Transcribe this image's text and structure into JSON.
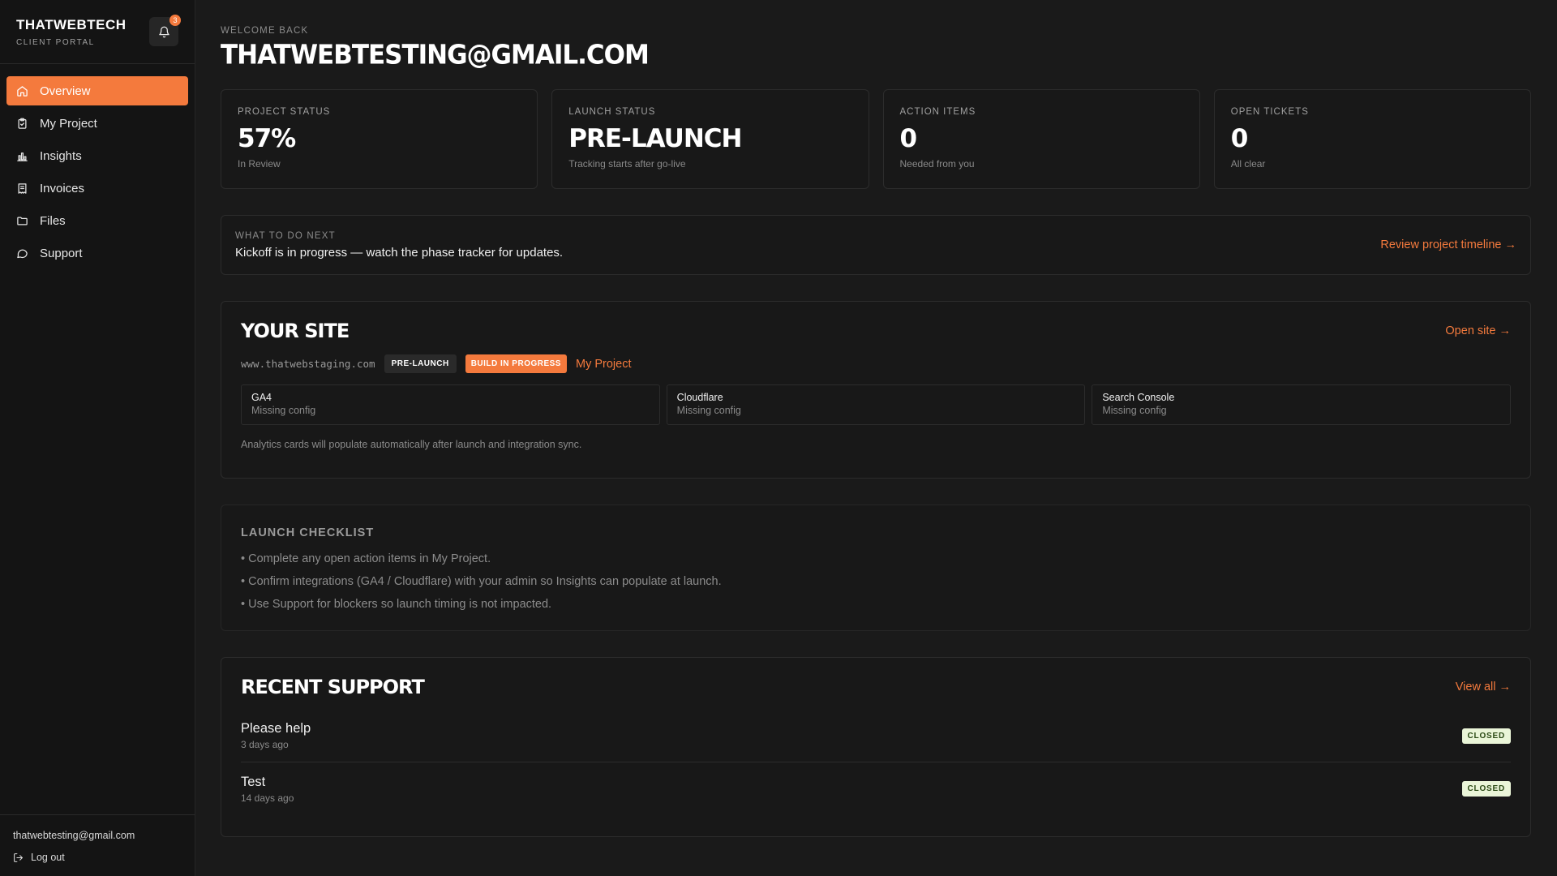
{
  "sidebar": {
    "brand_title": "THATWEBTECH",
    "brand_subtitle": "CLIENT PORTAL",
    "notification_count": "3",
    "nav": [
      {
        "label": "Overview",
        "icon": "home-icon",
        "active": true
      },
      {
        "label": "My Project",
        "icon": "clipboard-icon",
        "active": false
      },
      {
        "label": "Insights",
        "icon": "bar-chart-icon",
        "active": false
      },
      {
        "label": "Invoices",
        "icon": "receipt-icon",
        "active": false
      },
      {
        "label": "Files",
        "icon": "folder-icon",
        "active": false
      },
      {
        "label": "Support",
        "icon": "chat-bubble-icon",
        "active": false
      }
    ],
    "user_email": "thatwebtesting@gmail.com",
    "logout_label": "Log out"
  },
  "header": {
    "welcome": "WELCOME BACK",
    "title": "THATWEBTESTING@GMAIL.COM"
  },
  "stats": [
    {
      "label": "PROJECT STATUS",
      "value": "57%",
      "sub": "In Review"
    },
    {
      "label": "LAUNCH STATUS",
      "value": "PRE-LAUNCH",
      "sub": "Tracking starts after go-live"
    },
    {
      "label": "ACTION ITEMS",
      "value": "0",
      "sub": "Needed from you"
    },
    {
      "label": "OPEN TICKETS",
      "value": "0",
      "sub": "All clear"
    }
  ],
  "next_step": {
    "label": "WHAT TO DO NEXT",
    "text": "Kickoff is in progress — watch the phase tracker for updates.",
    "link": "Review project timeline →"
  },
  "site": {
    "title": "YOUR SITE",
    "open_link": "Open site →",
    "url": "www.thatwebstaging.com",
    "badge_launch": "PRE-LAUNCH",
    "badge_build": "BUILD IN PROGRESS",
    "project_link": "My Project",
    "integrations": [
      {
        "name": "GA4",
        "status": "Missing config"
      },
      {
        "name": "Cloudflare",
        "status": "Missing config"
      },
      {
        "name": "Search Console",
        "status": "Missing config"
      }
    ],
    "note": "Analytics cards will populate automatically after launch and integration sync."
  },
  "checklist": {
    "title": "LAUNCH CHECKLIST",
    "items": [
      "Complete any open action items in My Project.",
      "Confirm integrations (GA4 / Cloudflare) with your admin so Insights can populate at launch.",
      "Use Support for blockers so launch timing is not impacted."
    ]
  },
  "support": {
    "title": "RECENT SUPPORT",
    "view_all": "View all →",
    "tickets": [
      {
        "title": "Please help",
        "time": "3 days ago",
        "status": "CLOSED"
      },
      {
        "title": "Test",
        "time": "14 days ago",
        "status": "CLOSED"
      }
    ]
  },
  "colors": {
    "accent": "#f47a3d",
    "background": "#1a1a1a",
    "sidebar": "#141414",
    "closed_badge_bg": "#eaf5d8"
  }
}
